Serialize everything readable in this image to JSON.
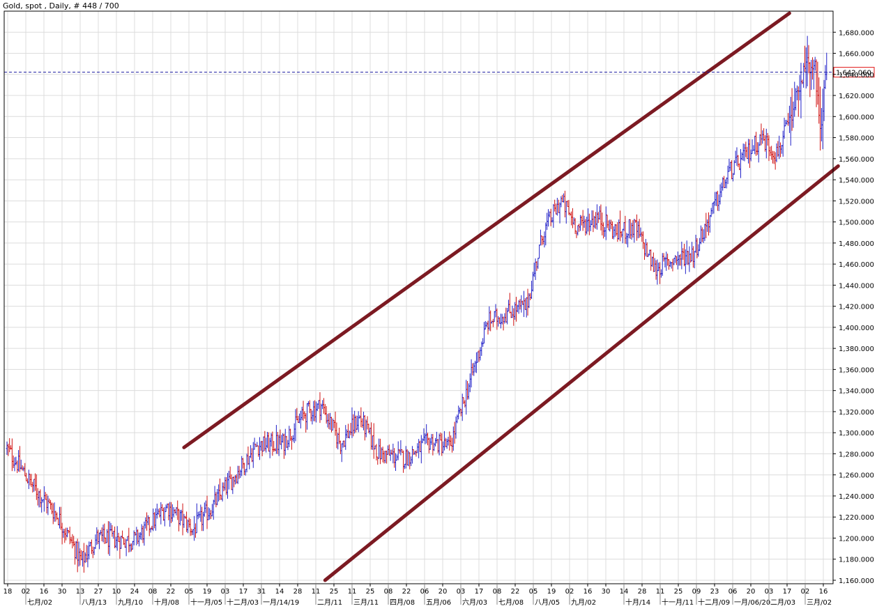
{
  "chart_data": {
    "type": "ohlc",
    "title": "Gold, spot , Daily, # 448 / 700",
    "xlabel": "",
    "ylabel": "",
    "ylim": [
      1160,
      1700
    ],
    "grid": true,
    "y_ticks": [
      "1,680.000",
      "1,660.000",
      "1,640.000",
      "1,620.000",
      "1,600.000",
      "1,580.000",
      "1,560.000",
      "1,540.000",
      "1,520.000",
      "1,500.000",
      "1,480.000",
      "1,460.000",
      "1,440.000",
      "1,420.000",
      "1,400.000",
      "1,380.000",
      "1,360.000",
      "1,340.000",
      "1,320.000",
      "1,300.000",
      "1,280.000",
      "1,260.000",
      "1,240.000",
      "1,220.000",
      "1,200.000",
      "1,180.000",
      "1,160.000"
    ],
    "x_ticks": [
      "18",
      "02",
      "16",
      "30",
      "13",
      "27",
      "10",
      "24",
      "08",
      "22",
      "05",
      "19",
      "03",
      "17",
      "31",
      "14",
      "28",
      "11",
      "25",
      "11",
      "25",
      "08",
      "22",
      "06",
      "20",
      "03",
      "17",
      "08",
      "22",
      "05",
      "19",
      "02",
      "16",
      "30",
      "14",
      "28",
      "11",
      "25",
      "09",
      "23",
      "06",
      "20",
      "03",
      "17",
      "02",
      "16"
    ],
    "x_month_labels": [
      "七月/02",
      "八月/13",
      "九月/10",
      "十月/08",
      "十一月/05",
      "十二月/03",
      "一月/14/19",
      "二月/11",
      "三月/11",
      "四月/08",
      "五月/06",
      "六月/03",
      "七月/08",
      "八月/05",
      "九月/02",
      "十月/14",
      "十一月/11",
      "十二月/09",
      "一月/06/20",
      "二月/03",
      "三月/02"
    ],
    "current_price": 1642.06,
    "current_price_label": "1,642.060",
    "key_points": [
      {
        "bar": 0,
        "price": 1285
      },
      {
        "bar": 20,
        "price": 1250
      },
      {
        "bar": 40,
        "price": 1220
      },
      {
        "bar": 58,
        "price": 1178
      },
      {
        "bar": 70,
        "price": 1200
      },
      {
        "bar": 100,
        "price": 1198
      },
      {
        "bar": 125,
        "price": 1230
      },
      {
        "bar": 145,
        "price": 1208
      },
      {
        "bar": 160,
        "price": 1230
      },
      {
        "bar": 175,
        "price": 1255
      },
      {
        "bar": 195,
        "price": 1288
      },
      {
        "bar": 215,
        "price": 1290
      },
      {
        "bar": 232,
        "price": 1318
      },
      {
        "bar": 245,
        "price": 1326
      },
      {
        "bar": 260,
        "price": 1290
      },
      {
        "bar": 275,
        "price": 1314
      },
      {
        "bar": 290,
        "price": 1280
      },
      {
        "bar": 310,
        "price": 1276
      },
      {
        "bar": 330,
        "price": 1292
      },
      {
        "bar": 345,
        "price": 1286
      },
      {
        "bar": 360,
        "price": 1345
      },
      {
        "bar": 375,
        "price": 1405
      },
      {
        "bar": 392,
        "price": 1415
      },
      {
        "bar": 405,
        "price": 1420
      },
      {
        "bar": 418,
        "price": 1490
      },
      {
        "bar": 432,
        "price": 1520
      },
      {
        "bar": 445,
        "price": 1495
      },
      {
        "bar": 460,
        "price": 1505
      },
      {
        "bar": 475,
        "price": 1490
      },
      {
        "bar": 490,
        "price": 1495
      },
      {
        "bar": 505,
        "price": 1455
      },
      {
        "bar": 520,
        "price": 1465
      },
      {
        "bar": 535,
        "price": 1470
      },
      {
        "bar": 548,
        "price": 1505
      },
      {
        "bar": 562,
        "price": 1545
      },
      {
        "bar": 575,
        "price": 1562
      },
      {
        "bar": 588,
        "price": 1580
      },
      {
        "bar": 600,
        "price": 1565
      },
      {
        "bar": 612,
        "price": 1600
      },
      {
        "bar": 622,
        "price": 1650
      },
      {
        "bar": 630,
        "price": 1645
      },
      {
        "bar": 634,
        "price": 1590
      },
      {
        "bar": 639,
        "price": 1642
      }
    ],
    "trend_lines": [
      {
        "name": "upper-channel",
        "start": {
          "bar": 138,
          "price": 1286
        },
        "end": {
          "bar": 610,
          "price": 1698
        },
        "color": "#7c1a22"
      },
      {
        "name": "lower-channel",
        "start": {
          "bar": 248,
          "price": 1160
        },
        "end": {
          "bar": 648,
          "price": 1553
        },
        "color": "#7c1a22"
      }
    ],
    "colors": {
      "up_bar": "#2020c8",
      "down_bar": "#d01010",
      "grid": "#dcdcdc",
      "price_line": "#1a1aa0",
      "price_label_border": "#e01010",
      "price_label_text": "#1a1aa0"
    }
  }
}
